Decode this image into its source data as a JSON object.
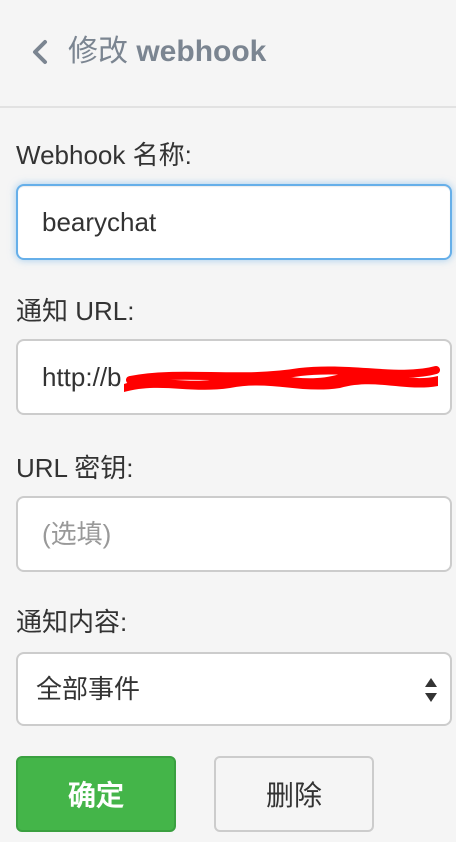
{
  "header": {
    "title_prefix": "修改",
    "title_suffix": "webhook"
  },
  "form": {
    "name": {
      "label": "Webhook 名称:",
      "value": "bearychat"
    },
    "url": {
      "label": "通知 URL:",
      "value": "http://b"
    },
    "secret": {
      "label": "URL 密钥:",
      "placeholder": "(选填)"
    },
    "content": {
      "label": "通知内容:",
      "selected": "全部事件"
    }
  },
  "actions": {
    "confirm_label": "确定",
    "delete_label": "删除"
  },
  "colors": {
    "confirm_bg": "#44b549",
    "focus_border": "#66afe9",
    "redaction": "#ff0000"
  }
}
